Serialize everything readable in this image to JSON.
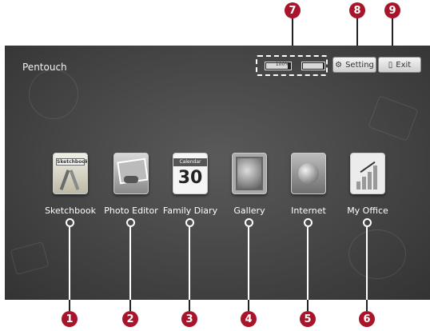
{
  "screen": {
    "title": "Pentouch"
  },
  "status": {
    "battery1_text": "100%",
    "battery1_level": 0.85,
    "battery2_level": 0.9
  },
  "buttons": {
    "setting_label": "Setting",
    "exit_label": "Exit"
  },
  "apps": [
    {
      "label": "Sketchbook",
      "marker": "1",
      "tile_text": "Sketchbook"
    },
    {
      "label": "Photo Editor",
      "marker": "2"
    },
    {
      "label": "Family Diary",
      "marker": "3",
      "tile_header": "Calendar",
      "tile_day": "30"
    },
    {
      "label": "Gallery",
      "marker": "4"
    },
    {
      "label": "Internet",
      "marker": "5"
    },
    {
      "label": "My Office",
      "marker": "6"
    }
  ],
  "callouts": {
    "battery_marker": "7",
    "setting_marker": "8",
    "exit_marker": "9"
  },
  "colors": {
    "marker": "#a8142a",
    "background": "#454545"
  }
}
